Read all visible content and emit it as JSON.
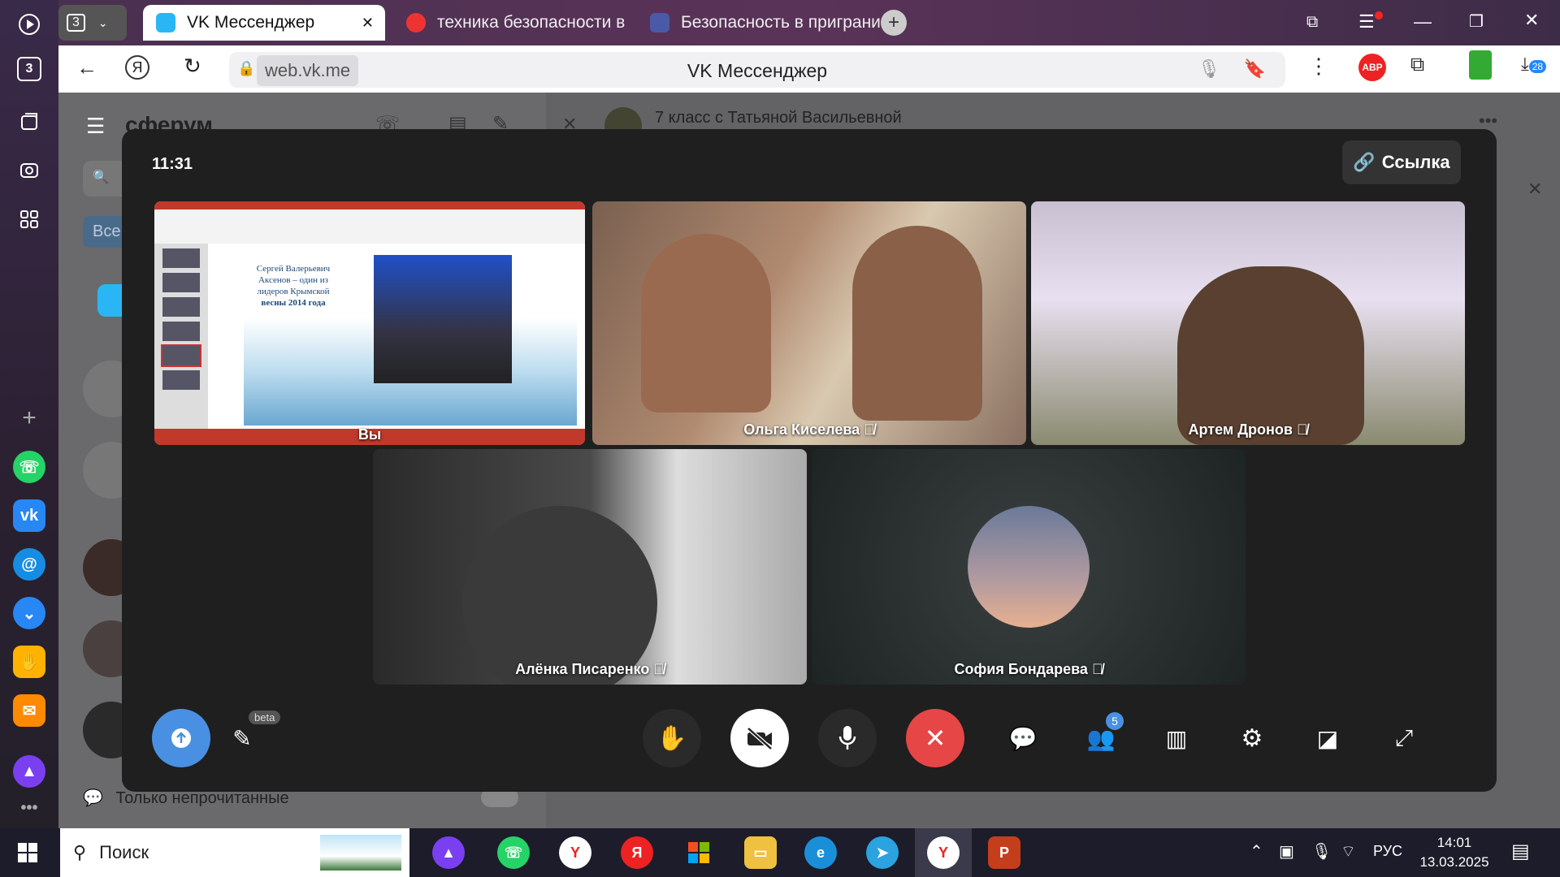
{
  "browser": {
    "tab_counter": "3",
    "tabs": [
      {
        "label": "VK Мессенджер"
      },
      {
        "label": "техника безопасности в п"
      },
      {
        "label": "Безопасность в пригранич"
      }
    ],
    "url": "web.vk.me",
    "page_title": "VK Мессенджер",
    "downloads_count": "28"
  },
  "vk": {
    "logo": "сферум",
    "search_tab": "Все",
    "chat_title": "7 класс с Татьяной Васильевной",
    "unread_only": "Только непрочитанные"
  },
  "call": {
    "time": "11:31",
    "link_button": "Ссылка",
    "participants": [
      {
        "name": "Вы"
      },
      {
        "name": "Ольга Киселева"
      },
      {
        "name": "Артем Дронов"
      },
      {
        "name": "Алёнка Писаренко"
      },
      {
        "name": "София Бондарева"
      }
    ],
    "slide": {
      "text_line1": "Сергей Валерьевич",
      "text_line2": "Аксенов – один из",
      "text_line3": "лидеров Крымской",
      "text_line4": "весны 2014 года"
    },
    "beta_label": "beta",
    "participants_count": "5"
  },
  "taskbar": {
    "search_placeholder": "Поиск",
    "lang": "РУС",
    "time": "14:01",
    "date": "13.03.2025"
  },
  "colors": {
    "accent_blue": "#4a90e2",
    "hangup_red": "#e64646"
  }
}
